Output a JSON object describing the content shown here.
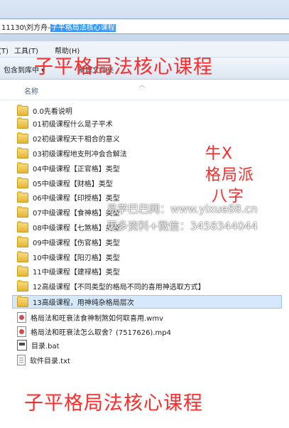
{
  "address": {
    "path_prefix": "11130\\刘方舟-",
    "path_selected": "子平格局法核心课程"
  },
  "menubar": {
    "items": [
      "具(T)",
      "工具(T)",
      "帮助(H)"
    ]
  },
  "toolbar": {
    "include_label": "包含到库中 ▾",
    "new_folder_label": "新建文件夹"
  },
  "column_header": {
    "name": "名称"
  },
  "files": [
    {
      "name": "0.0先看说明",
      "type": "folder"
    },
    {
      "name": "01初级课程什么是子平术",
      "type": "folder"
    },
    {
      "name": "02初级课程天干相合的意义",
      "type": "folder"
    },
    {
      "name": "03初级课程地支刑冲会合解法",
      "type": "folder"
    },
    {
      "name": "04中级课程【正官格】类型",
      "type": "folder"
    },
    {
      "name": "05中级课程【财格】类型",
      "type": "folder"
    },
    {
      "name": "06中级课程【印授格】类型",
      "type": "folder"
    },
    {
      "name": "07中级课程【食神格】类型",
      "type": "folder"
    },
    {
      "name": "08中级课程【七煞格】类型",
      "type": "folder"
    },
    {
      "name": "09中级课程【伤官格】类型",
      "type": "folder"
    },
    {
      "name": "10中级课程【阳刃格】类型",
      "type": "folder"
    },
    {
      "name": "11中级课程【建禄格】类型",
      "type": "folder"
    },
    {
      "name": "12高级课程【不同类型的格局不同的喜用神选取方式】",
      "type": "folder"
    },
    {
      "name": "13高级课程，用神纯杂格局层次",
      "type": "folder",
      "selected": true
    },
    {
      "name": "格局法和旺衰法食神制煞如何取喜用.wmv",
      "type": "video"
    },
    {
      "name": "格局法和旺衰法怎么取舍？(7517626).mp4",
      "type": "video"
    },
    {
      "name": "目录.bat",
      "type": "bat"
    },
    {
      "name": "软件目录.txt",
      "type": "txt"
    }
  ],
  "overlays": {
    "title_top": "子平格局法核心课程",
    "side_line1": "牛X",
    "side_line2": "格局派",
    "side_line3": "八字",
    "title_bottom": "子平格局法核心课程",
    "watermark_line1": "易学巴巴网：www.yixue88.cn",
    "watermark_line2": "更多资料+微信：3458344044"
  },
  "colors": {
    "overlay_red": "#ff2a2a",
    "selection": "#3399ff",
    "row_selected_bg": "#d6e8fb"
  }
}
